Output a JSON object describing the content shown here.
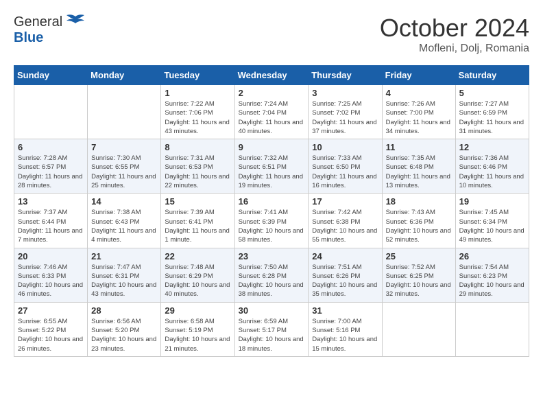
{
  "header": {
    "logo_general": "General",
    "logo_blue": "Blue",
    "month_title": "October 2024",
    "location": "Mofleni, Dolj, Romania"
  },
  "weekdays": [
    "Sunday",
    "Monday",
    "Tuesday",
    "Wednesday",
    "Thursday",
    "Friday",
    "Saturday"
  ],
  "weeks": [
    [
      {
        "day": "",
        "info": ""
      },
      {
        "day": "",
        "info": ""
      },
      {
        "day": "1",
        "info": "Sunrise: 7:22 AM\nSunset: 7:06 PM\nDaylight: 11 hours and 43 minutes."
      },
      {
        "day": "2",
        "info": "Sunrise: 7:24 AM\nSunset: 7:04 PM\nDaylight: 11 hours and 40 minutes."
      },
      {
        "day": "3",
        "info": "Sunrise: 7:25 AM\nSunset: 7:02 PM\nDaylight: 11 hours and 37 minutes."
      },
      {
        "day": "4",
        "info": "Sunrise: 7:26 AM\nSunset: 7:00 PM\nDaylight: 11 hours and 34 minutes."
      },
      {
        "day": "5",
        "info": "Sunrise: 7:27 AM\nSunset: 6:59 PM\nDaylight: 11 hours and 31 minutes."
      }
    ],
    [
      {
        "day": "6",
        "info": "Sunrise: 7:28 AM\nSunset: 6:57 PM\nDaylight: 11 hours and 28 minutes."
      },
      {
        "day": "7",
        "info": "Sunrise: 7:30 AM\nSunset: 6:55 PM\nDaylight: 11 hours and 25 minutes."
      },
      {
        "day": "8",
        "info": "Sunrise: 7:31 AM\nSunset: 6:53 PM\nDaylight: 11 hours and 22 minutes."
      },
      {
        "day": "9",
        "info": "Sunrise: 7:32 AM\nSunset: 6:51 PM\nDaylight: 11 hours and 19 minutes."
      },
      {
        "day": "10",
        "info": "Sunrise: 7:33 AM\nSunset: 6:50 PM\nDaylight: 11 hours and 16 minutes."
      },
      {
        "day": "11",
        "info": "Sunrise: 7:35 AM\nSunset: 6:48 PM\nDaylight: 11 hours and 13 minutes."
      },
      {
        "day": "12",
        "info": "Sunrise: 7:36 AM\nSunset: 6:46 PM\nDaylight: 11 hours and 10 minutes."
      }
    ],
    [
      {
        "day": "13",
        "info": "Sunrise: 7:37 AM\nSunset: 6:44 PM\nDaylight: 11 hours and 7 minutes."
      },
      {
        "day": "14",
        "info": "Sunrise: 7:38 AM\nSunset: 6:43 PM\nDaylight: 11 hours and 4 minutes."
      },
      {
        "day": "15",
        "info": "Sunrise: 7:39 AM\nSunset: 6:41 PM\nDaylight: 11 hours and 1 minute."
      },
      {
        "day": "16",
        "info": "Sunrise: 7:41 AM\nSunset: 6:39 PM\nDaylight: 10 hours and 58 minutes."
      },
      {
        "day": "17",
        "info": "Sunrise: 7:42 AM\nSunset: 6:38 PM\nDaylight: 10 hours and 55 minutes."
      },
      {
        "day": "18",
        "info": "Sunrise: 7:43 AM\nSunset: 6:36 PM\nDaylight: 10 hours and 52 minutes."
      },
      {
        "day": "19",
        "info": "Sunrise: 7:45 AM\nSunset: 6:34 PM\nDaylight: 10 hours and 49 minutes."
      }
    ],
    [
      {
        "day": "20",
        "info": "Sunrise: 7:46 AM\nSunset: 6:33 PM\nDaylight: 10 hours and 46 minutes."
      },
      {
        "day": "21",
        "info": "Sunrise: 7:47 AM\nSunset: 6:31 PM\nDaylight: 10 hours and 43 minutes."
      },
      {
        "day": "22",
        "info": "Sunrise: 7:48 AM\nSunset: 6:29 PM\nDaylight: 10 hours and 40 minutes."
      },
      {
        "day": "23",
        "info": "Sunrise: 7:50 AM\nSunset: 6:28 PM\nDaylight: 10 hours and 38 minutes."
      },
      {
        "day": "24",
        "info": "Sunrise: 7:51 AM\nSunset: 6:26 PM\nDaylight: 10 hours and 35 minutes."
      },
      {
        "day": "25",
        "info": "Sunrise: 7:52 AM\nSunset: 6:25 PM\nDaylight: 10 hours and 32 minutes."
      },
      {
        "day": "26",
        "info": "Sunrise: 7:54 AM\nSunset: 6:23 PM\nDaylight: 10 hours and 29 minutes."
      }
    ],
    [
      {
        "day": "27",
        "info": "Sunrise: 6:55 AM\nSunset: 5:22 PM\nDaylight: 10 hours and 26 minutes."
      },
      {
        "day": "28",
        "info": "Sunrise: 6:56 AM\nSunset: 5:20 PM\nDaylight: 10 hours and 23 minutes."
      },
      {
        "day": "29",
        "info": "Sunrise: 6:58 AM\nSunset: 5:19 PM\nDaylight: 10 hours and 21 minutes."
      },
      {
        "day": "30",
        "info": "Sunrise: 6:59 AM\nSunset: 5:17 PM\nDaylight: 10 hours and 18 minutes."
      },
      {
        "day": "31",
        "info": "Sunrise: 7:00 AM\nSunset: 5:16 PM\nDaylight: 10 hours and 15 minutes."
      },
      {
        "day": "",
        "info": ""
      },
      {
        "day": "",
        "info": ""
      }
    ]
  ]
}
